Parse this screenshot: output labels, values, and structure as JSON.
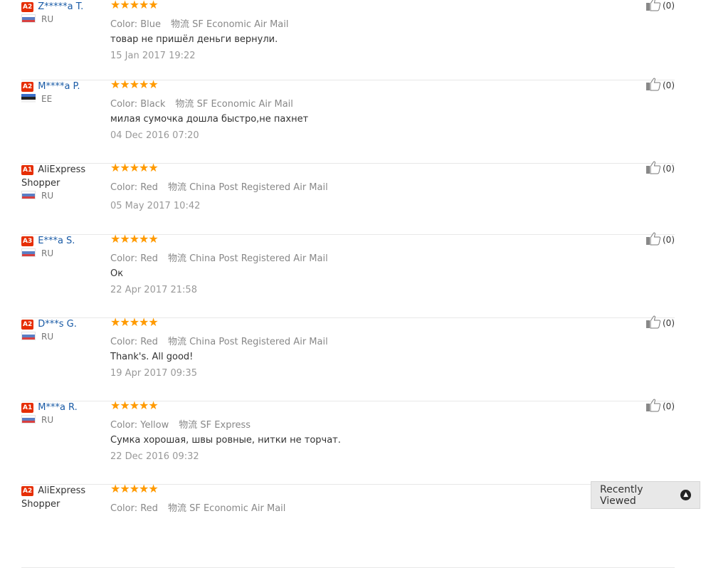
{
  "reviews": [
    {
      "badge": "A2",
      "name": "Z*****a T.",
      "masked": true,
      "country": "RU",
      "flag": "ru",
      "stars": "★★★★★",
      "color_label": "Color:",
      "color": "Blue",
      "ship_label": "物流",
      "shipping": "SF Economic Air Mail",
      "text": "товар не пришёл деньги вернули.",
      "date": "15 Jan 2017 19:22",
      "helpful": "(0)"
    },
    {
      "badge": "A2",
      "name": "M****a P.",
      "masked": true,
      "country": "EE",
      "flag": "ee",
      "stars": "★★★★★",
      "color_label": "Color:",
      "color": "Black",
      "ship_label": "物流",
      "shipping": "SF Economic Air Mail",
      "text": "милая сумочка дошла быстро,не пахнет",
      "date": "04 Dec 2016 07:20",
      "helpful": "(0)"
    },
    {
      "badge": "A1",
      "name": "AliExpress Shopper",
      "masked": false,
      "country": "RU",
      "flag": "ru",
      "stars": "★★★★★",
      "color_label": "Color:",
      "color": "Red",
      "ship_label": "物流",
      "shipping": "China Post Registered Air Mail",
      "text": "",
      "date": "05 May 2017 10:42",
      "helpful": "(0)"
    },
    {
      "badge": "A3",
      "name": "E***a S.",
      "masked": true,
      "country": "RU",
      "flag": "ru",
      "stars": "★★★★★",
      "color_label": "Color:",
      "color": "Red",
      "ship_label": "物流",
      "shipping": "China Post Registered Air Mail",
      "text": "Ок",
      "date": "22 Apr 2017 21:58",
      "helpful": "(0)"
    },
    {
      "badge": "A2",
      "name": "D***s G.",
      "masked": true,
      "country": "RU",
      "flag": "ru",
      "stars": "★★★★★",
      "color_label": "Color:",
      "color": "Red",
      "ship_label": "物流",
      "shipping": "China Post Registered Air Mail",
      "text": "Thank's. All good!",
      "date": "19 Apr 2017 09:35",
      "helpful": "(0)"
    },
    {
      "badge": "A1",
      "name": "M***a R.",
      "masked": true,
      "country": "RU",
      "flag": "ru",
      "stars": "★★★★★",
      "color_label": "Color:",
      "color": "Yellow",
      "ship_label": "物流",
      "shipping": "SF Express",
      "text": "Сумка хорошая, швы ровные, нитки не торчат.",
      "date": "22 Dec 2016 09:32",
      "helpful": "(0)"
    },
    {
      "badge": "A2",
      "name": "AliExpress Shopper",
      "masked": false,
      "country": "",
      "flag": "",
      "stars": "★★★★★",
      "color_label": "Color:",
      "color": "Red",
      "ship_label": "物流",
      "shipping": "SF Economic Air Mail",
      "text": "",
      "date": "",
      "helpful": ""
    }
  ],
  "recently_viewed": {
    "label": "Recently Viewed",
    "icon": "chevron-up-icon"
  },
  "colors": {
    "star": "#ff9a00",
    "badge": "#e62e04",
    "link": "#1a5ba6"
  }
}
